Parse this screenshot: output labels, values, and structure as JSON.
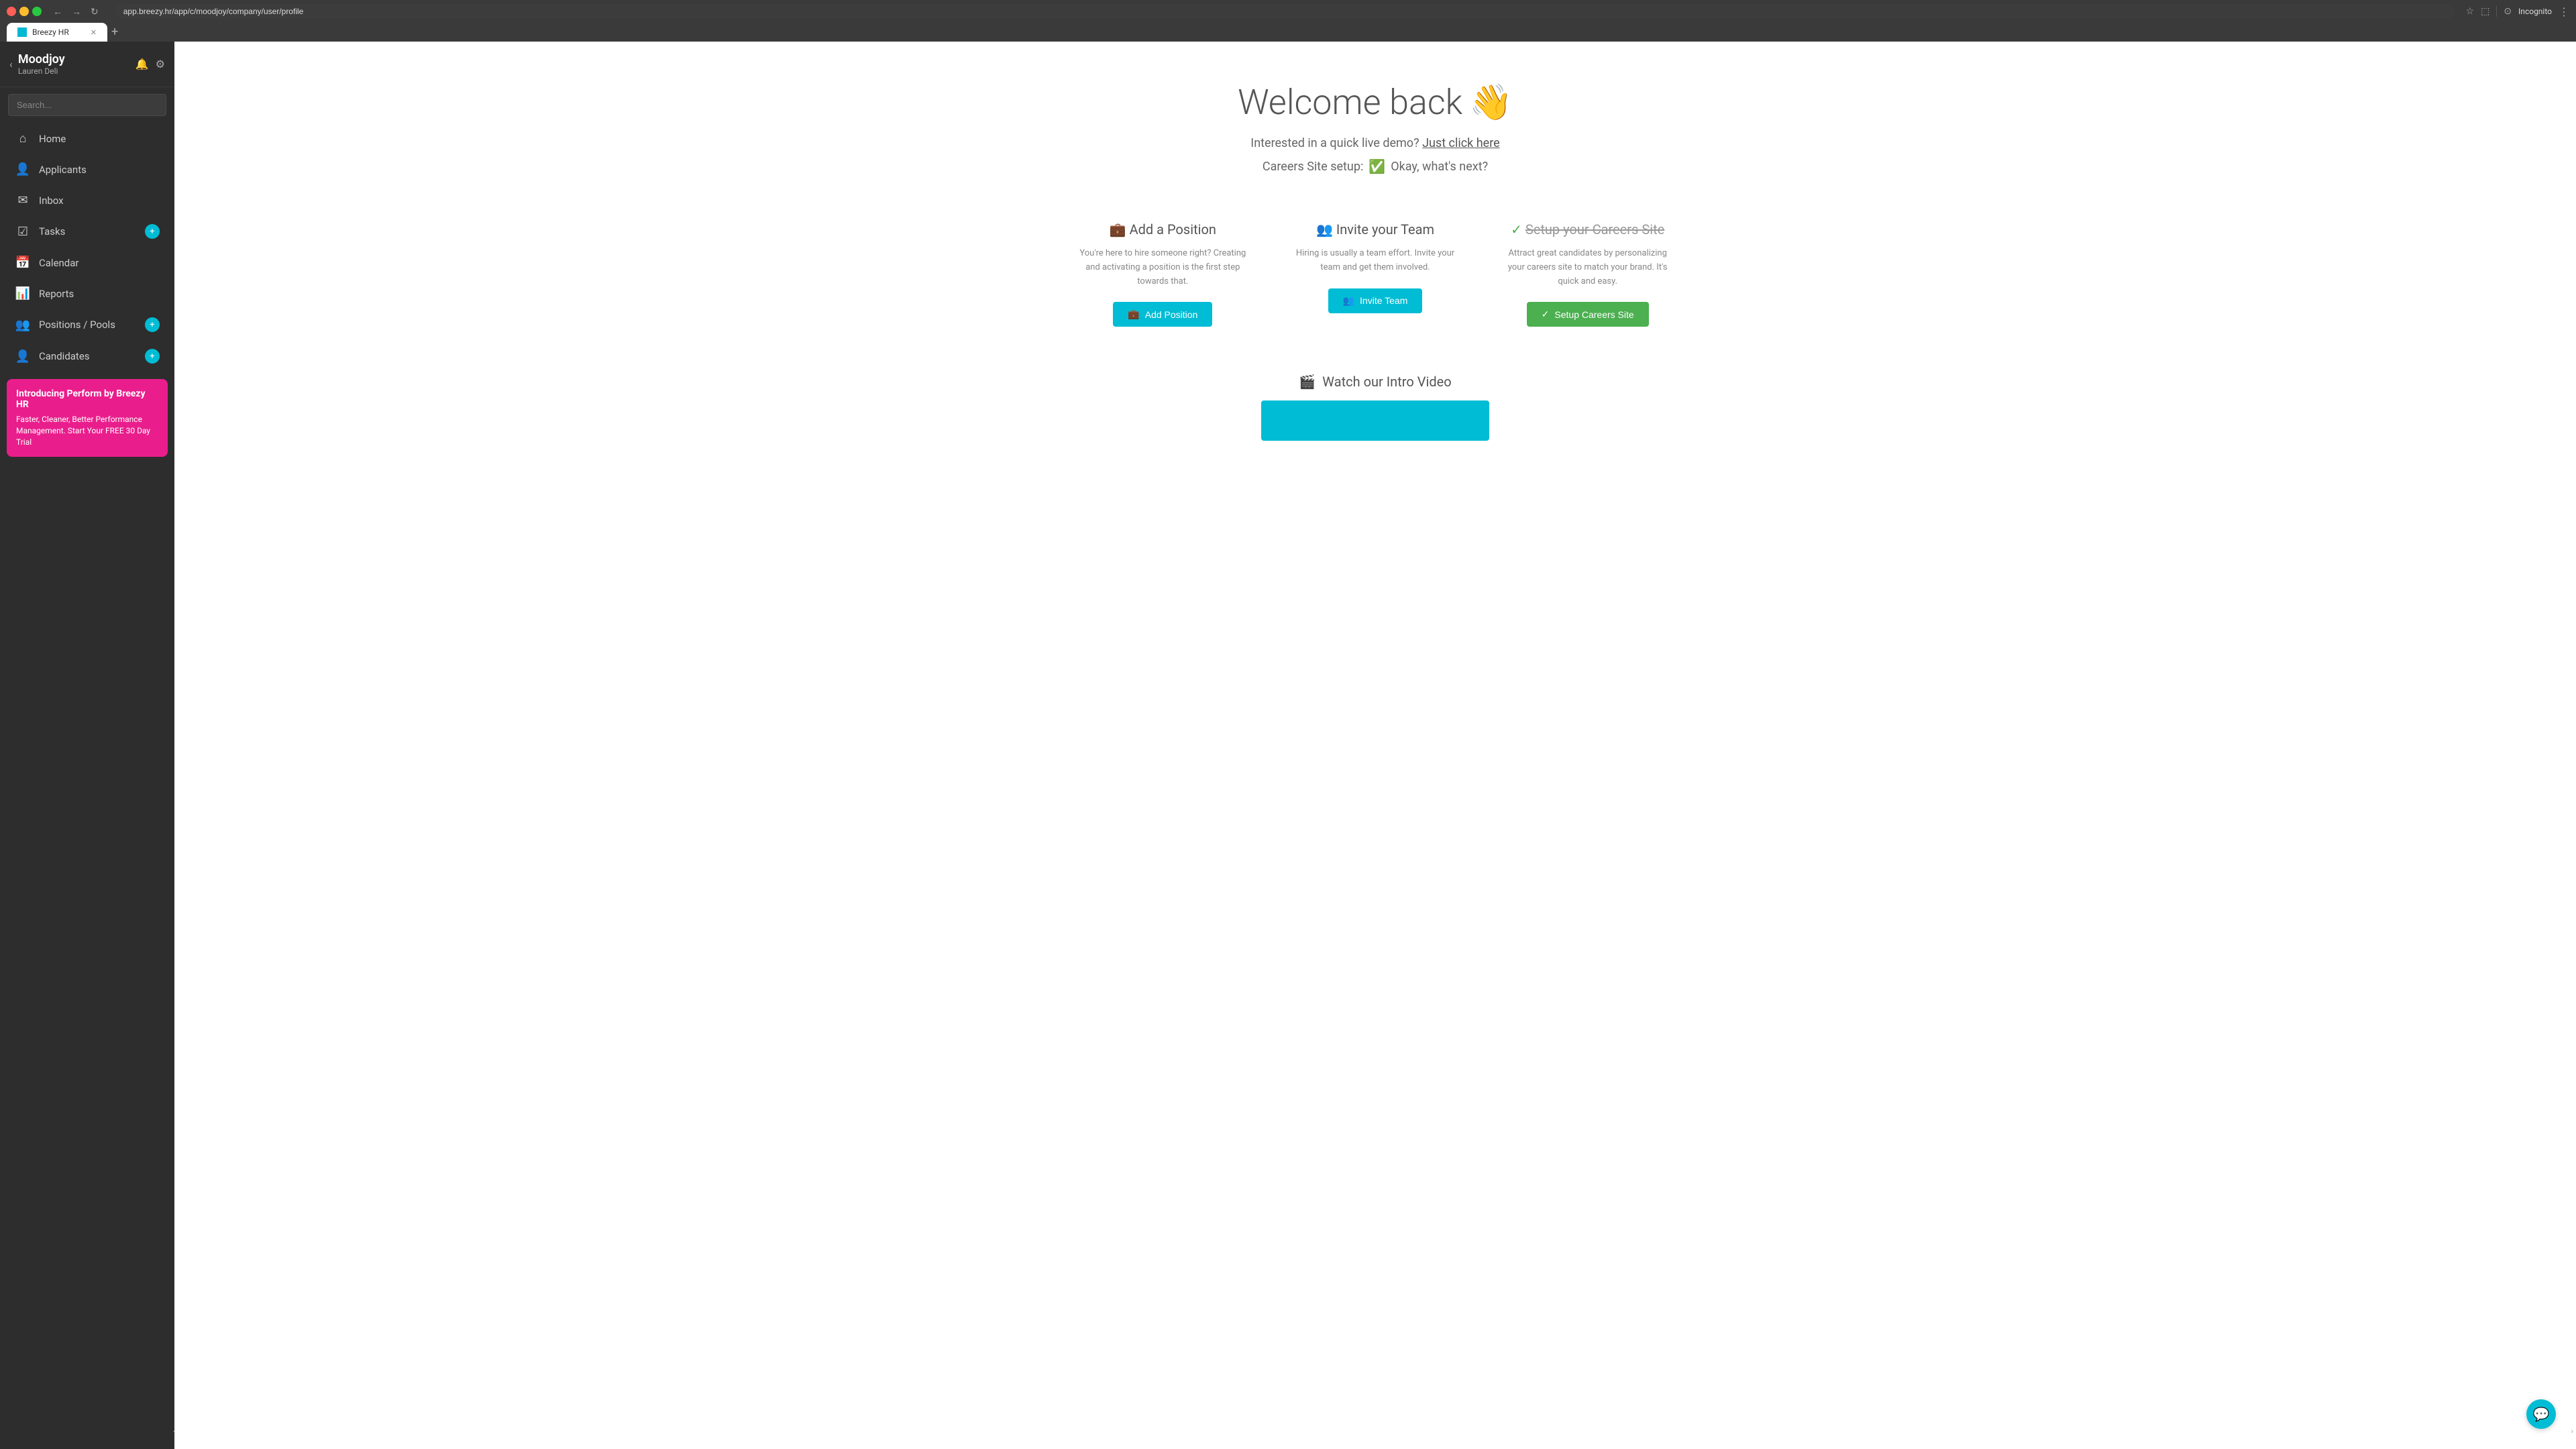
{
  "browser": {
    "tab_label": "Breezy HR",
    "address": "app.breezy.hr/app/c/moodjoy/company/user/profile",
    "tab_plus": "+",
    "incognito_label": "Incognito"
  },
  "sidebar": {
    "back_arrow": "‹",
    "company_name": "Moodjoy",
    "company_user": "Lauren Deli",
    "search_placeholder": "Search...",
    "nav_items": [
      {
        "id": "home",
        "icon": "⌂",
        "label": "Home",
        "badge": null
      },
      {
        "id": "applicants",
        "icon": "👤",
        "label": "Applicants",
        "badge": null
      },
      {
        "id": "inbox",
        "icon": "✉",
        "label": "Inbox",
        "badge": null
      },
      {
        "id": "tasks",
        "icon": "☑",
        "label": "Tasks",
        "badge": "+"
      },
      {
        "id": "calendar",
        "icon": "📅",
        "label": "Calendar",
        "badge": null
      },
      {
        "id": "reports",
        "icon": "📊",
        "label": "Reports",
        "badge": null
      },
      {
        "id": "positions-pools",
        "icon": "👥",
        "label": "Positions / Pools",
        "badge": "+"
      },
      {
        "id": "candidates",
        "icon": "👤",
        "label": "Candidates",
        "badge": "+"
      }
    ],
    "promo": {
      "title": "Introducing Perform by Breezy HR",
      "text": "Faster, Cleaner, Better Performance Management. Start Your FREE 30 Day Trial"
    }
  },
  "main": {
    "welcome_title": "Welcome back",
    "welcome_emoji": "👋",
    "demo_text": "Interested in a quick live demo?",
    "demo_link": "Just click here",
    "careers_text": "Careers Site setup:",
    "careers_check": "✅",
    "careers_next": "Okay, what's next?",
    "cards": [
      {
        "id": "add-position",
        "icon": "💼",
        "title": "Add a Position",
        "completed": false,
        "desc": "You're here to hire someone right? Creating and activating a position is the first step towards that.",
        "btn_label": "Add Position",
        "btn_icon": "💼",
        "btn_style": "cyan"
      },
      {
        "id": "invite-team",
        "icon": "👥",
        "title": "Invite your Team",
        "completed": false,
        "desc": "Hiring is usually a team effort. Invite your team and get them involved.",
        "btn_label": "Invite Team",
        "btn_icon": "👥",
        "btn_style": "cyan"
      },
      {
        "id": "setup-careers",
        "icon": "✓",
        "title": "Setup your Careers Site",
        "completed": true,
        "desc": "Attract great candidates by personalizing your careers site to match your brand. It's quick and easy.",
        "btn_label": "Setup Careers Site",
        "btn_icon": "✓",
        "btn_style": "green"
      }
    ],
    "video_title": "Watch our Intro Video",
    "video_icon": "🎬"
  },
  "chat_btn_icon": "💬"
}
